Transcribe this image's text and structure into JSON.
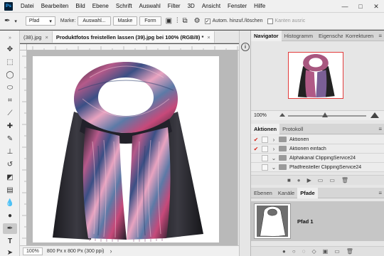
{
  "app": {
    "logo": "Ps"
  },
  "menu": [
    "Datei",
    "Bearbeiten",
    "Bild",
    "Ebene",
    "Schrift",
    "Auswahl",
    "Filter",
    "3D",
    "Ansicht",
    "Fenster",
    "Hilfe"
  ],
  "window_controls": {
    "minimize": "—",
    "maximize": "□",
    "close": "✕"
  },
  "options": {
    "mode_value": "Pfad",
    "marke_label": "Marke:",
    "auswahl_label": "Auswahl...",
    "maske_label": "Maske",
    "form_label": "Form",
    "auto_label": "Autom. hinzuf./löschen",
    "kanten_label": "Kanten ausric"
  },
  "tabs": [
    {
      "label": "(38).jpg",
      "active": false
    },
    {
      "label": "Produktfotos freistellen lassen (39).jpg bei 100% (RGB/8) *",
      "active": true
    }
  ],
  "tab_close": "×",
  "status": {
    "zoom": "100%",
    "info": "800 Px x 800 Px (300 ppi)",
    "arrow": "›"
  },
  "navigator": {
    "tabs": [
      "Navigator",
      "Histogramm",
      "Eigenschaften",
      "Korrekturen"
    ],
    "zoom": "100%",
    "menu_icon": "≡"
  },
  "actions": {
    "tabs": [
      "Aktionen",
      "Protokoll"
    ],
    "rows": [
      {
        "label": "Aktionen",
        "checked": true
      },
      {
        "label": "Aktionen einfach",
        "checked": true
      },
      {
        "label": "Alphakanal ClippingService24",
        "checked": false
      },
      {
        "label": "Pfadfreisteller ClippingService24",
        "checked": false
      }
    ],
    "buttons": [
      "■",
      "●",
      "▶",
      "▭",
      "▭",
      "🗑"
    ]
  },
  "layers": {
    "tabs": [
      "Ebenen",
      "Kanäle",
      "Pfade"
    ],
    "path_name": "Pfad 1",
    "buttons": [
      "●",
      "○",
      "◌",
      "◇",
      "▣",
      "▭",
      "🗑"
    ]
  },
  "colors": {
    "accent_red": "#d9261c",
    "ps_blue": "#31a8ff",
    "navigator_frame": "#e23b3b"
  }
}
